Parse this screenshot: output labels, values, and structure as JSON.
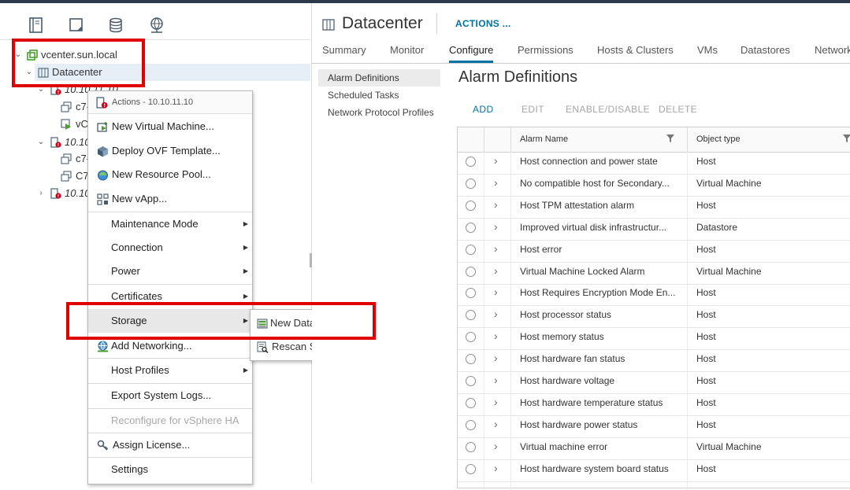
{
  "navigator": {
    "tabs": [
      {
        "icon": "hosts-clusters-icon"
      },
      {
        "icon": "vms-templates-icon"
      },
      {
        "icon": "storage-icon"
      },
      {
        "icon": "networking-icon"
      }
    ],
    "tree": {
      "vcenter": {
        "label": "vcenter.sun.local",
        "icon": "vcenter-icon"
      },
      "datacenter": {
        "label": "Datacenter",
        "icon": "datacenter-icon"
      },
      "host1": {
        "label": "10.10.11.10",
        "icon": "host-alert-icon"
      },
      "host1_vm1": {
        "label": "c7-",
        "icon": "vm-icon"
      },
      "host1_vm2": {
        "label": "vC",
        "icon": "vm-running-icon"
      },
      "host2": {
        "label": "10.10.",
        "icon": "host-alert-icon"
      },
      "host2_vm1": {
        "label": "c7-",
        "icon": "vm-icon"
      },
      "host2_vm2": {
        "label": "C7",
        "icon": "vm-icon"
      },
      "host3": {
        "label": "10.10.",
        "icon": "host-alert-icon"
      }
    }
  },
  "context_menu": {
    "header": "Actions - 10.10.11.10",
    "items": {
      "new_vm": "New Virtual Machine...",
      "deploy_ovf": "Deploy OVF Template...",
      "new_pool": "New Resource Pool...",
      "new_vapp": "New vApp...",
      "maintenance": "Maintenance Mode",
      "connection": "Connection",
      "power": "Power",
      "certificates": "Certificates",
      "storage": "Storage",
      "add_networking": "Add Networking...",
      "host_profiles": "Host Profiles",
      "export_logs": "Export System Logs...",
      "reconfigure_ha": "Reconfigure for vSphere HA",
      "assign_license": "Assign License...",
      "settings": "Settings"
    },
    "storage_submenu": {
      "new_datastore": "New Datastore...",
      "rescan_storage": "Rescan Storage..."
    }
  },
  "content": {
    "object_title": "Datacenter",
    "actions_label": "ACTIONS ...",
    "tabs": {
      "summary": "Summary",
      "monitor": "Monitor",
      "configure": "Configure",
      "permissions": "Permissions",
      "hosts_clusters": "Hosts & Clusters",
      "vms": "VMs",
      "datastores": "Datastores",
      "networks": "Networks"
    },
    "active_tab": "Configure",
    "subnav": {
      "alarm_definitions": "Alarm Definitions",
      "scheduled_tasks": "Scheduled Tasks",
      "network_protocol_profiles": "Network Protocol Profiles"
    },
    "panel_title": "Alarm Definitions",
    "toolbar": {
      "add": "ADD",
      "edit": "EDIT",
      "enable_disable": "ENABLE/DISABLE",
      "delete": "DELETE"
    },
    "grid": {
      "columns": {
        "name": "Alarm Name",
        "type": "Object type"
      },
      "rows": [
        {
          "name": "Host connection and power state",
          "type": "Host"
        },
        {
          "name": "No compatible host for Secondary...",
          "type": "Virtual Machine"
        },
        {
          "name": "Host TPM attestation alarm",
          "type": "Host"
        },
        {
          "name": "Improved virtual disk infrastructur...",
          "type": "Datastore"
        },
        {
          "name": "Host error",
          "type": "Host"
        },
        {
          "name": "Virtual Machine Locked Alarm",
          "type": "Virtual Machine"
        },
        {
          "name": "Host Requires Encryption Mode En...",
          "type": "Host"
        },
        {
          "name": "Host processor status",
          "type": "Host"
        },
        {
          "name": "Host memory status",
          "type": "Host"
        },
        {
          "name": "Host hardware fan status",
          "type": "Host"
        },
        {
          "name": "Host hardware voltage",
          "type": "Host"
        },
        {
          "name": "Host hardware temperature status",
          "type": "Host"
        },
        {
          "name": "Host hardware power status",
          "type": "Host"
        },
        {
          "name": "Virtual machine error",
          "type": "Virtual Machine"
        },
        {
          "name": "Host hardware system board status",
          "type": "Host"
        }
      ]
    }
  },
  "colors": {
    "accent": "#0072a3",
    "highlight_box": "#e10000",
    "selection": "#e6eef6",
    "vcenter_green": "#4a9e2f",
    "alert_red": "#d0021b"
  }
}
